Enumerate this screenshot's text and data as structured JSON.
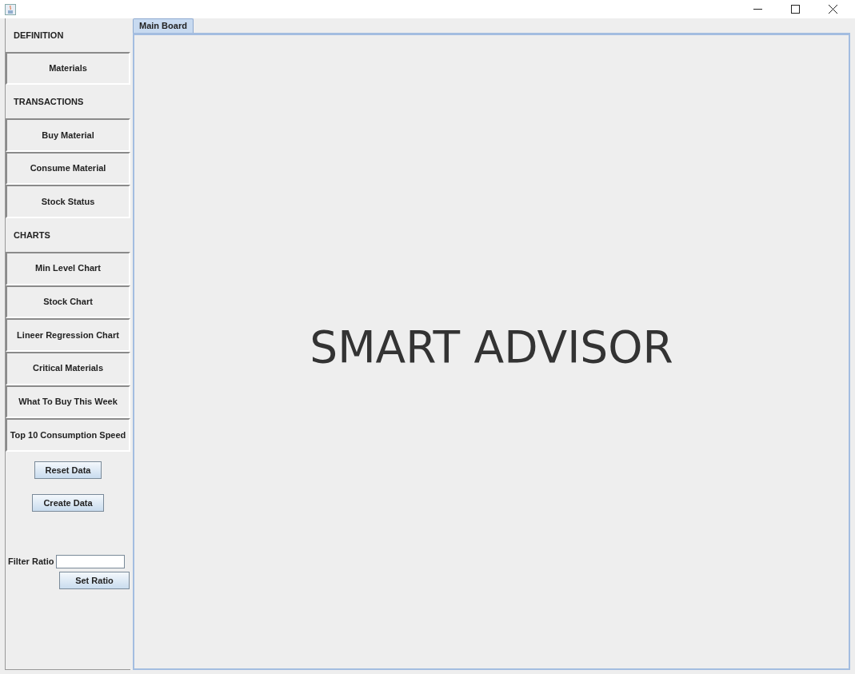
{
  "sidebar": {
    "items": [
      {
        "kind": "header",
        "label": "DEFINITION"
      },
      {
        "kind": "button",
        "label": "Materials"
      },
      {
        "kind": "header",
        "label": "TRANSACTIONS"
      },
      {
        "kind": "button",
        "label": "Buy Material"
      },
      {
        "kind": "button",
        "label": "Consume Material"
      },
      {
        "kind": "button",
        "label": "Stock Status"
      },
      {
        "kind": "header",
        "label": "CHARTS"
      },
      {
        "kind": "button",
        "label": "Min Level Chart"
      },
      {
        "kind": "button",
        "label": "Stock Chart"
      },
      {
        "kind": "button",
        "label": "Lineer Regression Chart"
      },
      {
        "kind": "button",
        "label": "Critical Materials"
      },
      {
        "kind": "button",
        "label": "What To Buy This Week"
      },
      {
        "kind": "button",
        "label": "Top 10 Consumption Speed"
      }
    ],
    "actions": [
      "Reset Data",
      "Create Data"
    ],
    "filter": {
      "label": "Filter Ratio",
      "button": "Set Ratio"
    }
  },
  "tabs": [
    {
      "label": "Main Board",
      "selected": true
    }
  ],
  "main": {
    "title": "SMART ADVISOR"
  }
}
